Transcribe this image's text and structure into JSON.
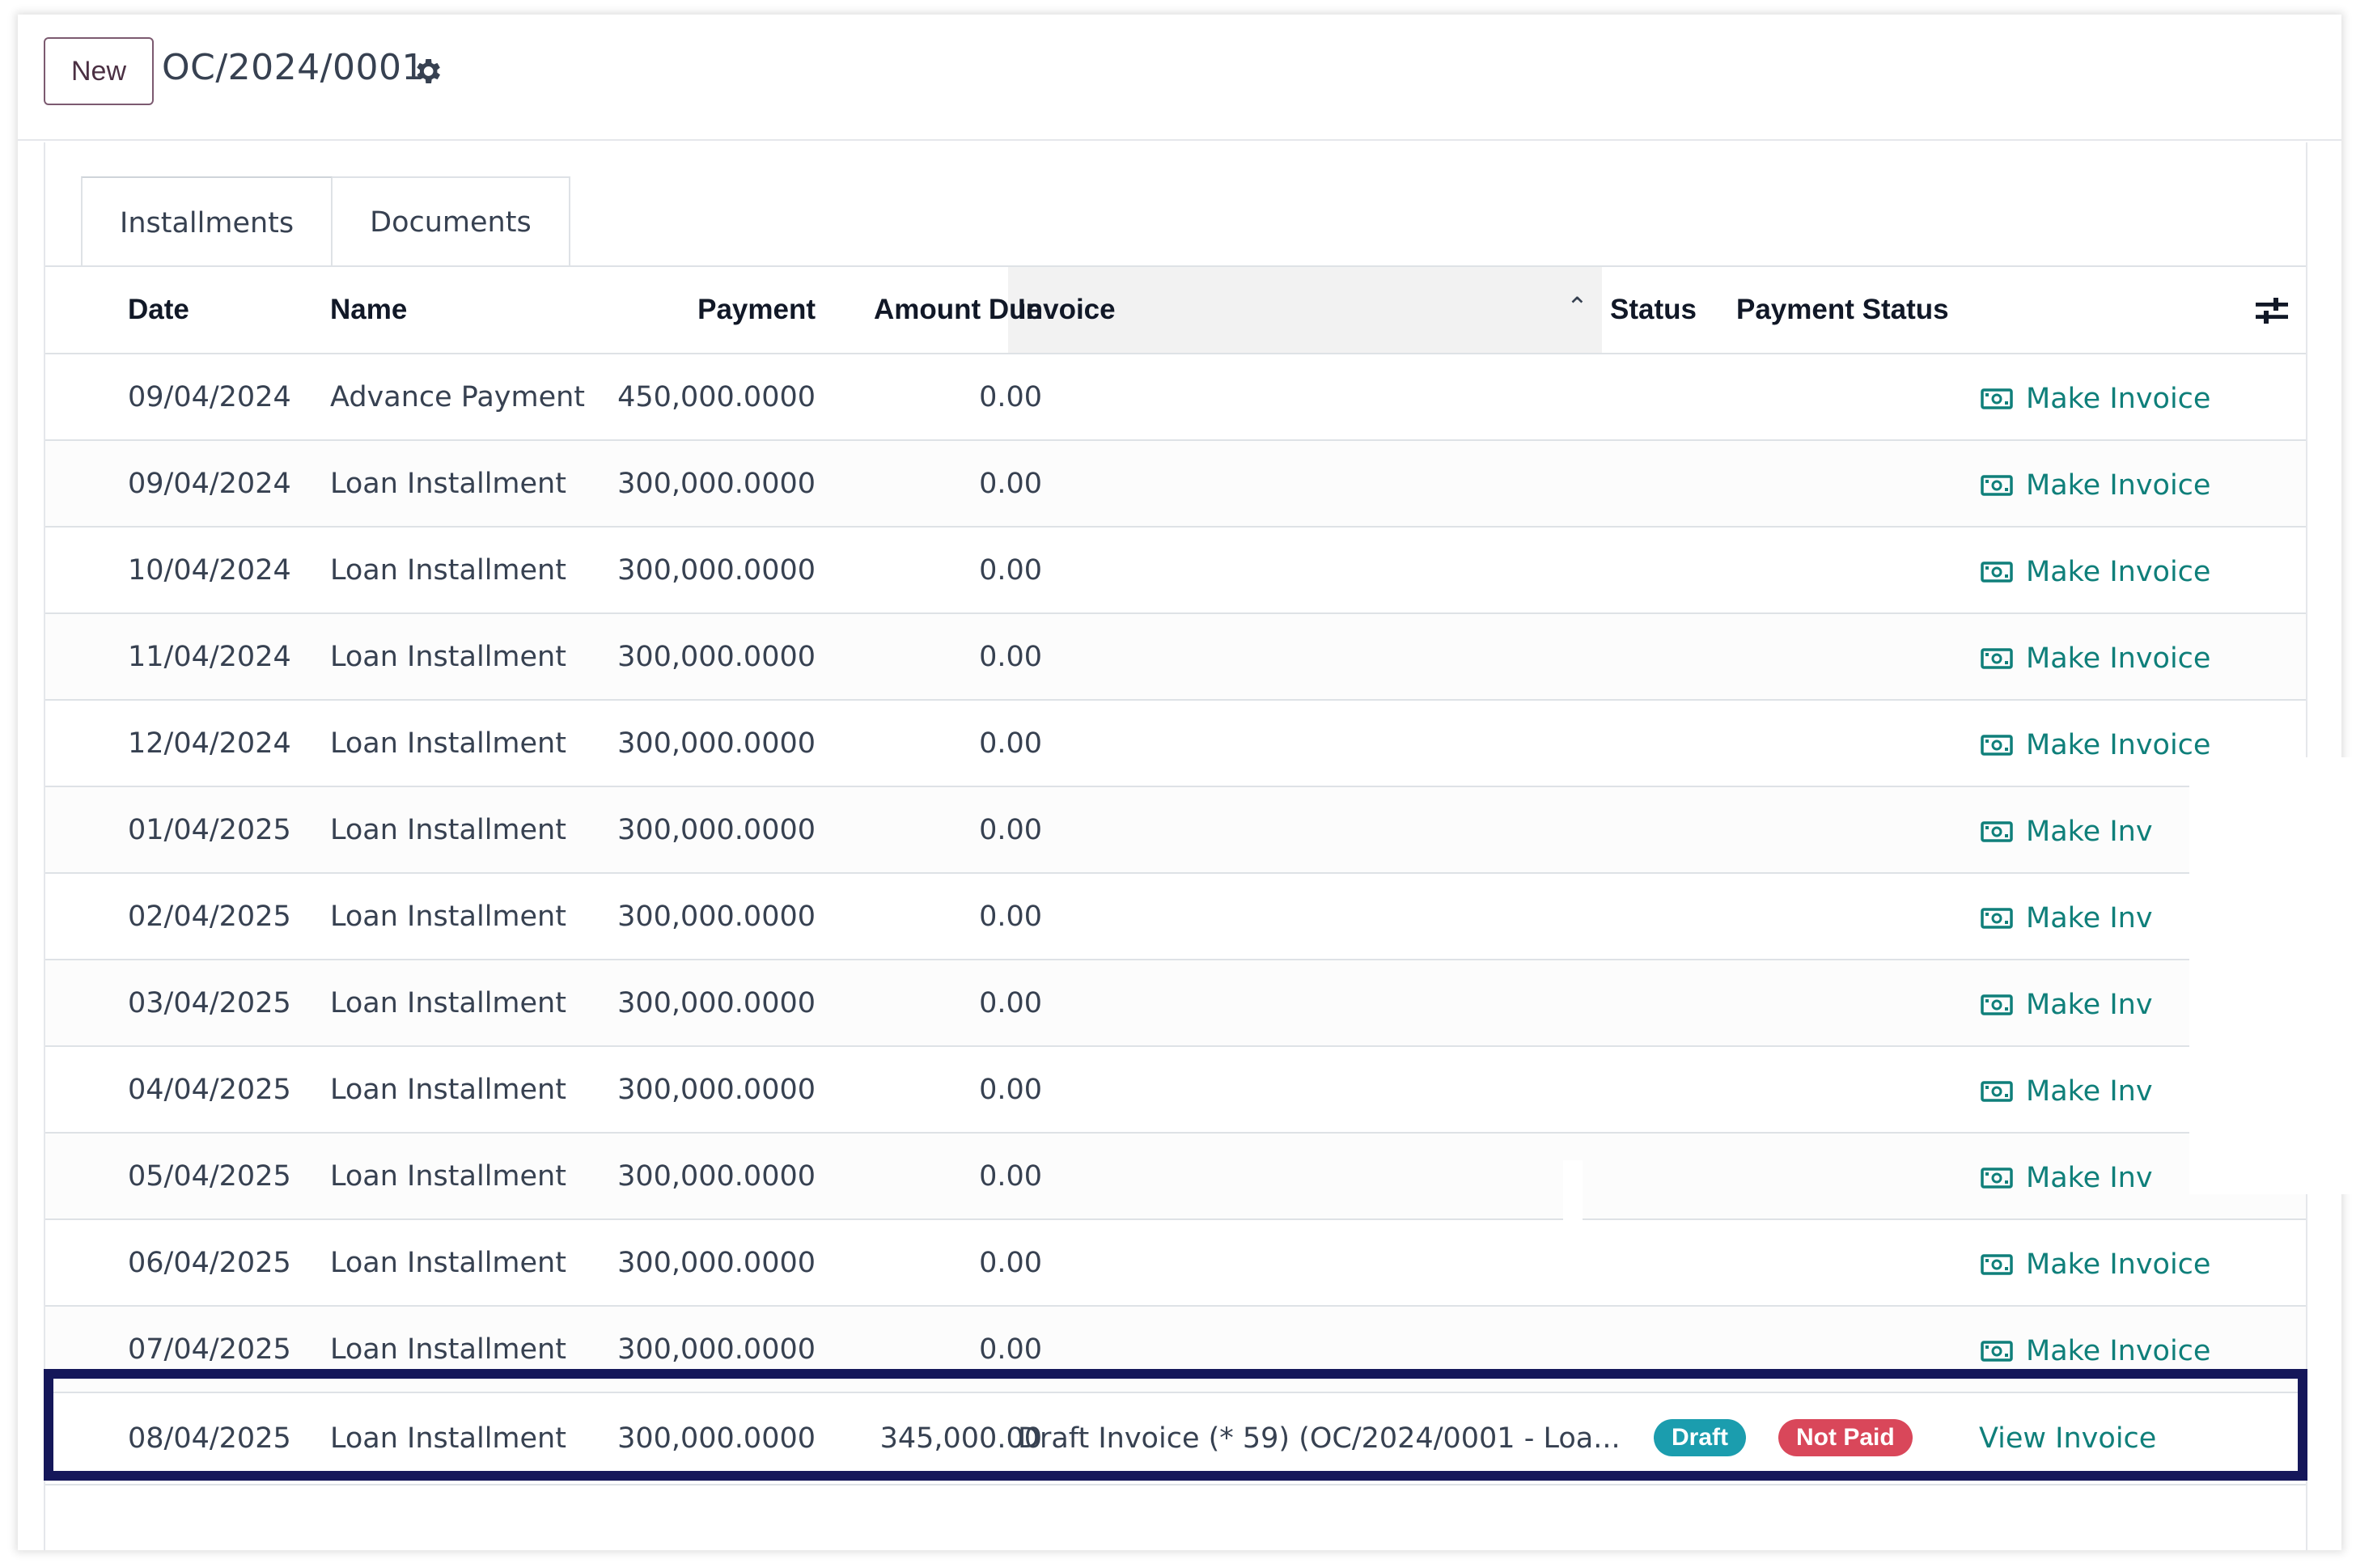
{
  "header": {
    "new_label": "New",
    "record_title": "OC/2024/0001",
    "gear_icon": "gear-icon"
  },
  "tabs": [
    {
      "label": "Installments",
      "active": true
    },
    {
      "label": "Documents",
      "active": false
    }
  ],
  "table": {
    "columns": {
      "date": "Date",
      "name": "Name",
      "payment": "Payment",
      "amount_due": "Amount Due",
      "invoice": "Invoice",
      "status": "Status",
      "payment_status": "Payment Status"
    },
    "rows": [
      {
        "date": "09/04/2024",
        "name": "Advance Payment",
        "payment": "450,000.0000",
        "amount_due": "0.00",
        "action": "Make Invoice"
      },
      {
        "date": "09/04/2024",
        "name": "Loan Installment",
        "payment": "300,000.0000",
        "amount_due": "0.00",
        "action": "Make Invoice"
      },
      {
        "date": "10/04/2024",
        "name": "Loan Installment",
        "payment": "300,000.0000",
        "amount_due": "0.00",
        "action": "Make Invoice"
      },
      {
        "date": "11/04/2024",
        "name": "Loan Installment",
        "payment": "300,000.0000",
        "amount_due": "0.00",
        "action": "Make Invoice"
      },
      {
        "date": "12/04/2024",
        "name": "Loan Installment",
        "payment": "300,000.0000",
        "amount_due": "0.00",
        "action": "Make Invoice"
      },
      {
        "date": "01/04/2025",
        "name": "Loan Installment",
        "payment": "300,000.0000",
        "amount_due": "0.00",
        "action": "Make Inv"
      },
      {
        "date": "02/04/2025",
        "name": "Loan Installment",
        "payment": "300,000.0000",
        "amount_due": "0.00",
        "action": "Make Inv"
      },
      {
        "date": "03/04/2025",
        "name": "Loan Installment",
        "payment": "300,000.0000",
        "amount_due": "0.00",
        "action": "Make Inv"
      },
      {
        "date": "04/04/2025",
        "name": "Loan Installment",
        "payment": "300,000.0000",
        "amount_due": "0.00",
        "action": "Make Inv"
      },
      {
        "date": "05/04/2025",
        "name": "Loan Installment",
        "payment": "300,000.0000",
        "amount_due": "0.00",
        "action": "Make Inv"
      },
      {
        "date": "06/04/2025",
        "name": "Loan Installment",
        "payment": "300,000.0000",
        "amount_due": "0.00",
        "action": "Make Invoice"
      },
      {
        "date": "07/04/2025",
        "name": "Loan Installment",
        "payment": "300,000.0000",
        "amount_due": "0.00",
        "action": "Make Invoice"
      }
    ],
    "highlighted_row": {
      "date": "08/04/2025",
      "name": "Loan Installment",
      "payment": "300,000.0000",
      "amount_due": "345,000.00",
      "invoice": "Draft Invoice (* 59) (OC/2024/0001 - Loa...",
      "status_badge": "Draft",
      "payment_status_badge": "Not Paid",
      "action": "View Invoice"
    }
  },
  "colors": {
    "accent": "#0f7f7a",
    "draft_badge": "#1b9dae",
    "not_paid_badge": "#d9475a",
    "highlight_border": "#15175a"
  }
}
